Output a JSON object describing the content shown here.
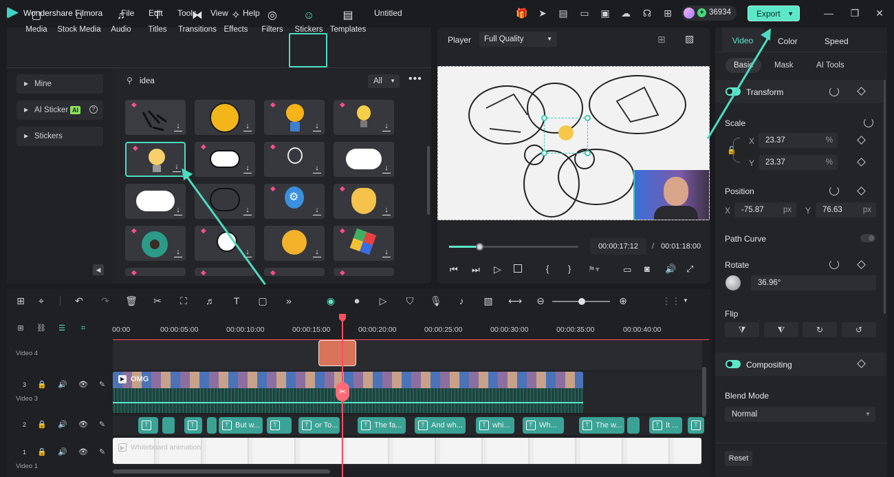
{
  "app": {
    "name": "Wondershare Filmora",
    "doc_title": "Untitled",
    "credits": "36934",
    "export_label": "Export"
  },
  "menu": [
    "File",
    "Edit",
    "Tools",
    "View",
    "Help"
  ],
  "media_tabs": [
    {
      "label": "Media",
      "icon": "media-icon"
    },
    {
      "label": "Stock Media",
      "icon": "stock-media-icon"
    },
    {
      "label": "Audio",
      "icon": "audio-icon"
    },
    {
      "label": "Titles",
      "icon": "titles-icon"
    },
    {
      "label": "Transitions",
      "icon": "transitions-icon"
    },
    {
      "label": "Effects",
      "icon": "effects-icon"
    },
    {
      "label": "Filters",
      "icon": "filters-icon"
    },
    {
      "label": "Stickers",
      "icon": "stickers-icon"
    },
    {
      "label": "Templates",
      "icon": "templates-icon"
    }
  ],
  "sidebar": {
    "items": [
      {
        "label": "Mine"
      },
      {
        "label": "AI Sticker",
        "badge": "AI"
      },
      {
        "label": "Stickers"
      }
    ]
  },
  "search": {
    "value": "idea",
    "filter": "All"
  },
  "player": {
    "label": "Player",
    "quality": "Full Quality",
    "current_time": "00:00:17:12",
    "total_time": "00:01:18:00",
    "separator": "/"
  },
  "props": {
    "tabs": [
      "Video",
      "Color",
      "Speed"
    ],
    "subtabs": [
      "Basic",
      "Mask",
      "AI Tools"
    ],
    "transform": "Transform",
    "scale": "Scale",
    "scale_x_label": "X",
    "scale_x": "23.37",
    "scale_y_label": "Y",
    "scale_y": "23.37",
    "pct": "%",
    "position": "Position",
    "pos_x_label": "X",
    "pos_x": "-75.87",
    "pos_y_label": "Y",
    "pos_y": "76.63",
    "px": "px",
    "path_curve": "Path Curve",
    "rotate": "Rotate",
    "rotate_value": "36.96°",
    "flip": "Flip",
    "compositing": "Compositing",
    "blend_mode": "Blend Mode",
    "blend_value": "Normal",
    "reset": "Reset"
  },
  "timeline": {
    "ruler": [
      "00:00",
      "00:00:05:00",
      "00:00:10:00",
      "00:00:15:00",
      "00:00:20:00",
      "00:00:25:00",
      "00:00:30:00",
      "00:00:35:00",
      "00:00:40:00"
    ],
    "tracks": [
      {
        "label": "Video 4",
        "num": "4"
      },
      {
        "label": "Video 3",
        "num": "3"
      },
      {
        "label": "",
        "num": "2"
      },
      {
        "label": "Video 1",
        "num": "1"
      }
    ],
    "video3_clip": "OMG",
    "video1_clip": "Whiteboard animation",
    "title_clips": [
      "",
      "",
      "",
      "",
      "But w...",
      "",
      "or To...",
      "The fa...",
      "And wh...",
      "whi...",
      "Wh...",
      "The w...",
      "",
      "It ...",
      ""
    ]
  },
  "colors": {
    "accent": "#5ce8c8",
    "playhead": "#ff4d5e",
    "clip_title": "#3aa396",
    "clip_orange": "#d9735a"
  }
}
